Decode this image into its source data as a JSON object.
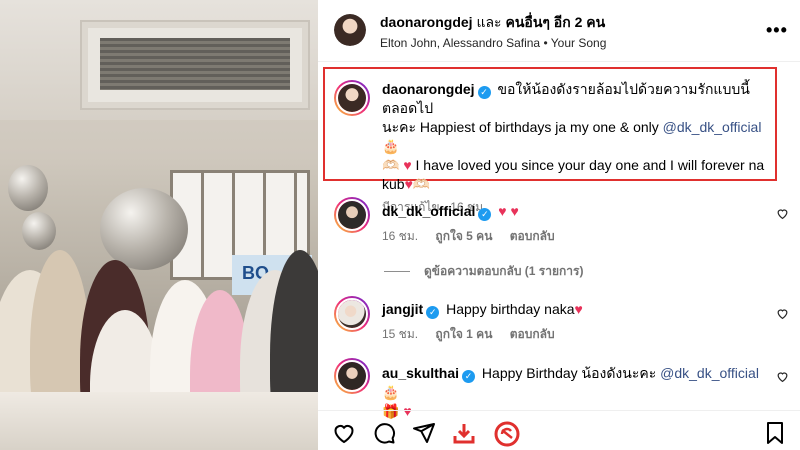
{
  "post": {
    "header": {
      "username": "daonarongdej",
      "and_text": "และ",
      "others_text": "คนอื่นๆ อีก 2 คน",
      "music": "Elton John, Alessandro Safina • Your Song",
      "more_label": "•••"
    },
    "caption": {
      "username": "daonarongdej",
      "text_part1": "ขอให้น้องดังรายล้อมไปด้วยความรักแบบนี้ตลอดไป",
      "text_part2": "นะคะ Happiest of birthdays ja my one & only",
      "mention": "@dk_dk_official",
      "emoji1": "🎂",
      "emoji2": "🫶🏻",
      "heart": "♥",
      "text_part3": "I have loved you since your day one and I will forever na",
      "text_part4": "kub",
      "emoji3": "🫶🏻",
      "edited_label": "มีการแก้ไข",
      "time": "16 ชม."
    },
    "comments": [
      {
        "username": "dk_dk_official",
        "text": "♥ ♥",
        "time": "16 ชม.",
        "likes": "ถูกใจ 5 คน",
        "reply_label": "ตอบกลับ",
        "view_replies": "ดูข้อความตอบกลับ (1 รายการ)"
      },
      {
        "username": "jangjit",
        "text": "Happy birthday naka",
        "heart": "♥",
        "time": "15 ชม.",
        "likes": "ถูกใจ 1 คน",
        "reply_label": "ตอบกลับ"
      },
      {
        "username": "au_skulthai",
        "text_part1": "Happy Birthday น้องดังนะคะ",
        "mention": "@dk_dk_official",
        "emoji1": "🎂",
        "emoji2": "🎁",
        "heart": "♥"
      }
    ],
    "verified_mark": "✓",
    "photo": {
      "sign_text": "BO-"
    },
    "colors": {
      "highlight_border": "#e0302e",
      "heart": "#e8325a",
      "verified": "#1d9bf0",
      "mention": "#385185",
      "save_icon_accent": "#e0302e"
    }
  }
}
